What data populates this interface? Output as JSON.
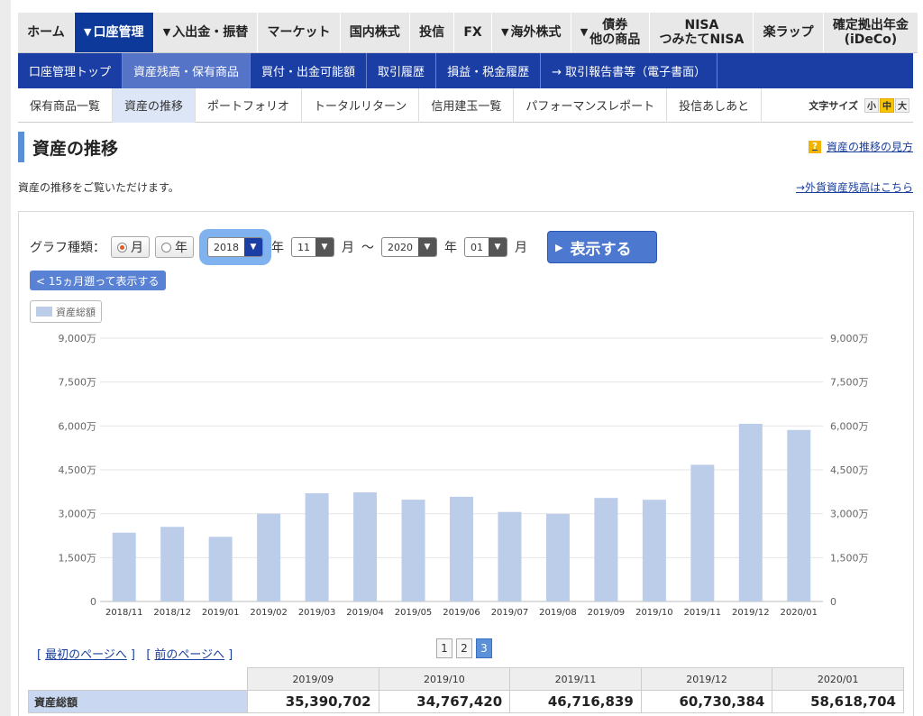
{
  "main_nav": [
    {
      "label": "ホーム",
      "arrow": false,
      "active": false
    },
    {
      "label": "口座管理",
      "arrow": true,
      "active": true
    },
    {
      "label": "入出金・振替",
      "arrow": true,
      "active": false
    },
    {
      "label": "マーケット",
      "arrow": false,
      "active": false
    },
    {
      "label": "国内株式",
      "arrow": false,
      "active": false
    },
    {
      "label": "投信",
      "arrow": false,
      "active": false
    },
    {
      "label": "FX",
      "arrow": false,
      "active": false
    },
    {
      "label": "海外株式",
      "arrow": true,
      "active": false
    },
    {
      "label": "債券\n他の商品",
      "arrow": true,
      "active": false
    },
    {
      "label": "NISA\nつみたてNISA",
      "arrow": false,
      "active": false
    },
    {
      "label": "楽ラップ",
      "arrow": false,
      "active": false
    },
    {
      "label": "確定拠出年金\n(iDeCo)",
      "arrow": false,
      "active": false
    }
  ],
  "sub_nav": [
    {
      "label": "口座管理トップ",
      "active": false
    },
    {
      "label": "資産残高・保有商品",
      "active": true
    },
    {
      "label": "買付・出金可能額",
      "active": false
    },
    {
      "label": "取引履歴",
      "active": false
    },
    {
      "label": "損益・税金履歴",
      "active": false
    },
    {
      "label": "→ 取引報告書等（電子書面）",
      "active": false
    }
  ],
  "tabs": [
    {
      "label": "保有商品一覧",
      "active": false
    },
    {
      "label": "資産の推移",
      "active": true
    },
    {
      "label": "ポートフォリオ",
      "active": false
    },
    {
      "label": "トータルリターン",
      "active": false
    },
    {
      "label": "信用建玉一覧",
      "active": false
    },
    {
      "label": "パフォーマンスレポート",
      "active": false
    },
    {
      "label": "投信あしあと",
      "active": false
    }
  ],
  "font_size": {
    "label": "文字サイズ",
    "small": "小",
    "medium": "中",
    "large": "大"
  },
  "page": {
    "title": "資産の推移",
    "help_link": "資産の推移の見方",
    "help_icon": "?",
    "description": "資産の推移をご覧いただけます。",
    "fx_link": "→外貨資産残高はこちら"
  },
  "controls": {
    "graph_type_label": "グラフ種類：",
    "month_label": "月",
    "year_label": "年",
    "from_year": "2018",
    "from_month": "11",
    "to_year": "2020",
    "to_month": "01",
    "year_unit": "年",
    "month_unit": "月",
    "range_sep": "〜",
    "show_button": "表示する",
    "back_button": "< 15ヵ月遡って表示する"
  },
  "colors": {
    "bar": "#bccde9",
    "grid": "#e6e6e6",
    "axis_text": "#666666",
    "accent": "#1b3ea5"
  },
  "chart_data": {
    "type": "bar",
    "title": "",
    "legend": "資産総額",
    "legend_position": "top-left",
    "xlabel": "",
    "ylabel": "",
    "grid": true,
    "ylim": [
      0,
      90000000
    ],
    "y_ticks": [
      0,
      15000000,
      30000000,
      45000000,
      60000000,
      75000000,
      90000000
    ],
    "y_tick_labels": [
      "0",
      "1,500万",
      "3,000万",
      "4,500万",
      "6,000万",
      "7,500万",
      "9,000万"
    ],
    "categories": [
      "2018/11",
      "2018/12",
      "2019/01",
      "2019/02",
      "2019/03",
      "2019/04",
      "2019/05",
      "2019/06",
      "2019/07",
      "2019/08",
      "2019/09",
      "2019/10",
      "2019/11",
      "2019/12",
      "2020/01"
    ],
    "series": [
      {
        "name": "資産総額",
        "values": [
          23500000,
          25500000,
          22100000,
          30000000,
          37000000,
          37300000,
          34800000,
          35800000,
          30600000,
          29900000,
          35390702,
          34767420,
          46716839,
          60730384,
          58618704
        ]
      }
    ]
  },
  "pager": {
    "first": "最初のページへ",
    "prev": "前のページへ",
    "pages": [
      "1",
      "2",
      "3"
    ],
    "current": "3"
  },
  "table": {
    "columns": [
      "2019/09",
      "2019/10",
      "2019/11",
      "2019/12",
      "2020/01"
    ],
    "rows": [
      {
        "label": "資産総額",
        "values": [
          "35,390,702",
          "34,767,420",
          "46,716,839",
          "60,730,384",
          "58,618,704"
        ]
      }
    ]
  }
}
